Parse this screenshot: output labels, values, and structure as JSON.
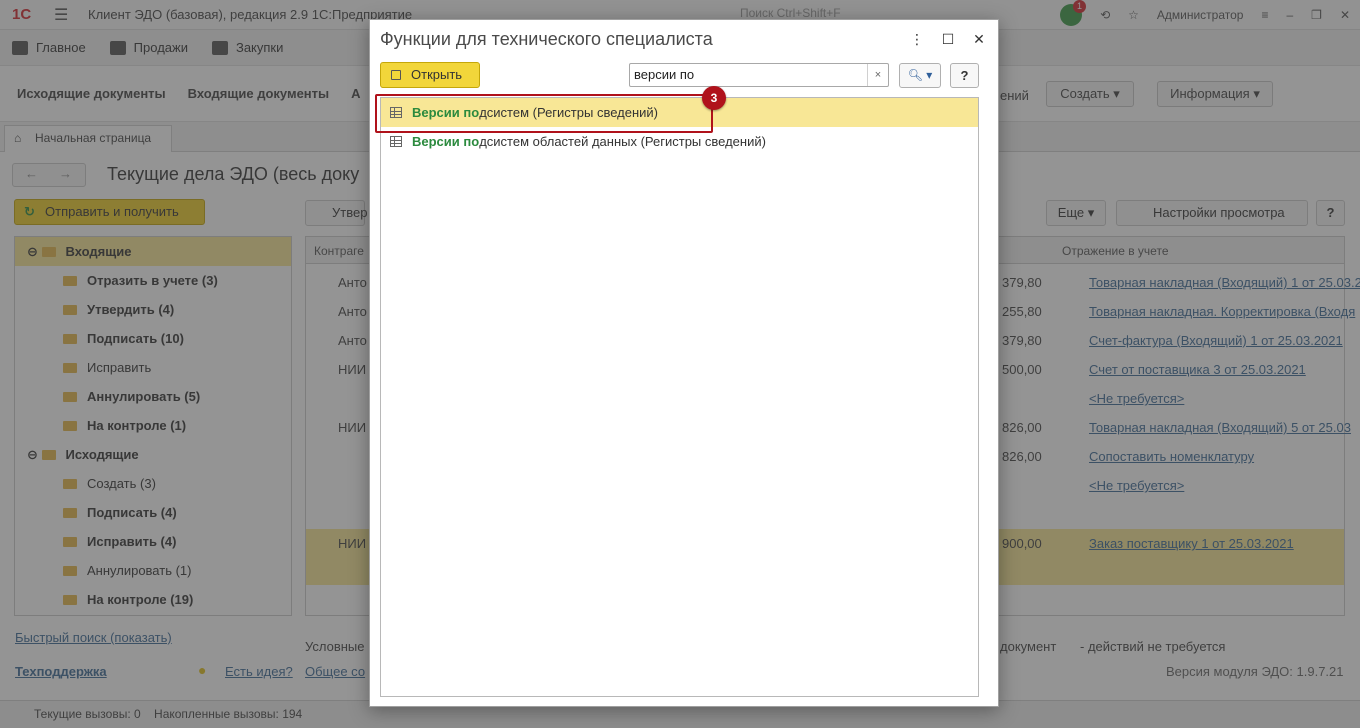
{
  "app": {
    "logo": "1С",
    "title": "Клиент ЭДО (базовая), редакция 2.9 1С:Предприятие",
    "search_placeholder": "Поиск Ctrl+Shift+F",
    "notification_count": "1",
    "user": "Администратор"
  },
  "sections": [
    "Главное",
    "Продажи",
    "Закупки"
  ],
  "panel": {
    "links": [
      "Исходящие документы",
      "Входящие документы",
      "А"
    ],
    "right_link_fragment": "ений",
    "create_label": "Создать",
    "info_label": "Информация"
  },
  "tabs": {
    "home": "Начальная страница"
  },
  "content": {
    "title": "Текущие дела ЭДО (весь доку",
    "send_receive": "Отправить и получить",
    "approve_fragment": "Утвер",
    "more_label": "Еще",
    "view_settings": "Настройки просмотра",
    "help": "?"
  },
  "tree": [
    {
      "label": "Входящие",
      "level": 0,
      "bold": true
    },
    {
      "label": "Отразить в учете (3)",
      "level": 1,
      "bold": true
    },
    {
      "label": "Утвердить (4)",
      "level": 1,
      "bold": true
    },
    {
      "label": "Подписать (10)",
      "level": 1,
      "bold": true
    },
    {
      "label": "Исправить",
      "level": 1,
      "bold": false
    },
    {
      "label": "Аннулировать (5)",
      "level": 1,
      "bold": true
    },
    {
      "label": "На контроле (1)",
      "level": 1,
      "bold": true
    },
    {
      "label": "Исходящие",
      "level": 0,
      "bold": true
    },
    {
      "label": "Создать (3)",
      "level": 1,
      "bold": false
    },
    {
      "label": "Подписать (4)",
      "level": 1,
      "bold": true
    },
    {
      "label": "Исправить (4)",
      "level": 1,
      "bold": true
    },
    {
      "label": "Аннулировать (1)",
      "level": 1,
      "bold": false
    },
    {
      "label": "На контроле (19)",
      "level": 1,
      "bold": true
    }
  ],
  "grid": {
    "col_counterparty": "Контраге",
    "col_reflection": "Отражение в учете",
    "rows": [
      {
        "counterparty": "Анто",
        "amount": "379,80",
        "reflection": "Товарная накладная (Входящий) 1 от 25.03.2"
      },
      {
        "counterparty": "Анто",
        "amount": "255,80",
        "reflection": "Товарная накладная. Корректировка (Входя"
      },
      {
        "counterparty": "Анто",
        "amount": "379,80",
        "reflection": "Счет-фактура (Входящий) 1 от 25.03.2021"
      },
      {
        "counterparty": "НИИ",
        "amount": "500,00",
        "reflection": "Счет от поставщика 3 от 25.03.2021"
      },
      {
        "counterparty": "",
        "amount": "",
        "reflection": "<Не требуется>"
      },
      {
        "counterparty": "НИИ",
        "amount": "826,00",
        "reflection": "Товарная накладная (Входящий) 5 от 25.03"
      },
      {
        "counterparty": "",
        "amount": "826,00",
        "reflection": "Сопоставить номенклатуру"
      },
      {
        "counterparty": "",
        "amount": "",
        "reflection": "<Не требуется>"
      },
      {
        "counterparty": "НИИ",
        "amount": "900,00",
        "reflection": "Заказ поставщику 1 от 25.03.2021"
      }
    ]
  },
  "footer": {
    "quick_search": "Быстрый поиск (показать)",
    "conditional": "Условные",
    "support": "Техподдержка",
    "idea": "Есть идея?",
    "general": "Общее со",
    "legend_doc": "документ",
    "legend_none": "- действий не требуется",
    "module_version": "Версия модуля ЭДО: 1.9.7.21"
  },
  "status": {
    "current_calls": "Текущие вызовы: 0",
    "accumulated_calls": "Накопленные вызовы: 194"
  },
  "dialog": {
    "title": "Функции для технического специалиста",
    "open_label": "Открыть",
    "search_value": "версии по",
    "clear": "×",
    "help": "?",
    "results": [
      {
        "hit1": "Версии",
        "hit2": "по",
        "rest": "дсистем (Регистры сведений)",
        "selected": true
      },
      {
        "hit1": "Версии",
        "hit2": "по",
        "rest": "дсистем областей данных (Регистры сведений)",
        "selected": false
      }
    ]
  },
  "callout": {
    "number": "3",
    "color": "#b0121b"
  }
}
